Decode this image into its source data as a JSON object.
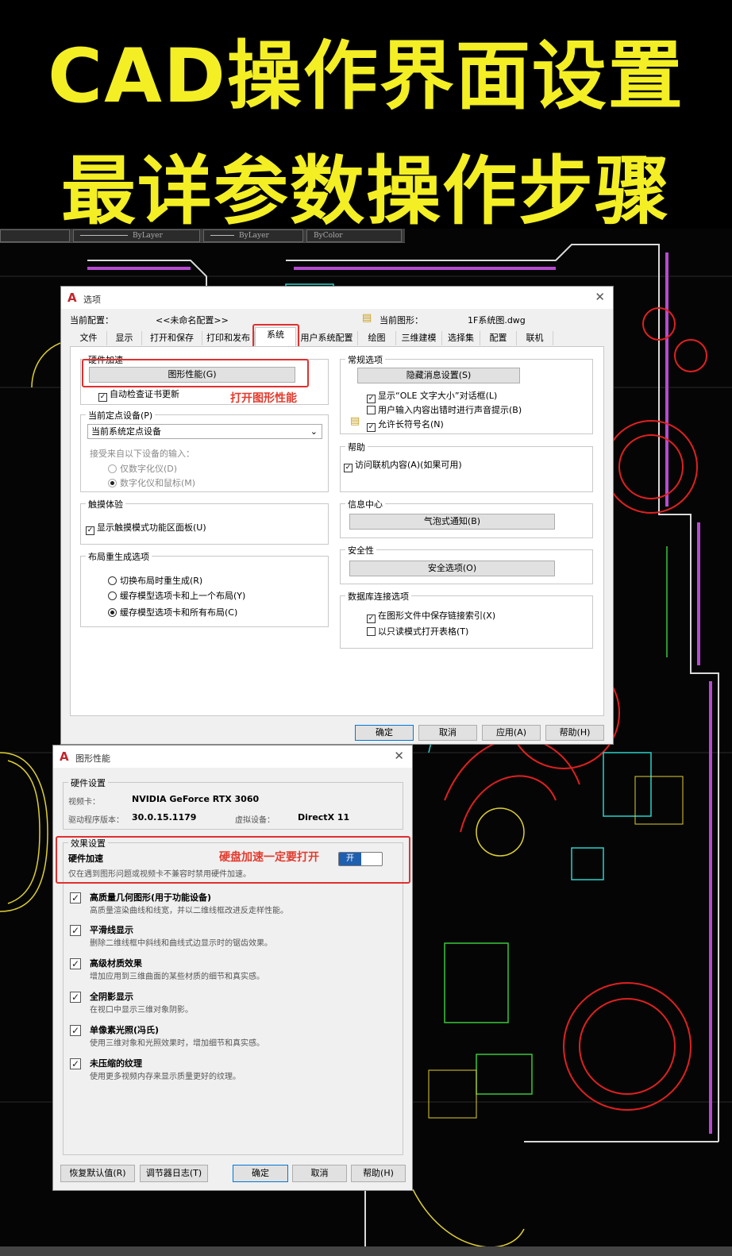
{
  "headline": {
    "line1": "CAD操作界面设置",
    "line2": "最详参数操作步骤"
  },
  "cad_toolbar": {
    "layer1": "ByLayer",
    "layer2": "ByLayer",
    "color": "ByColor"
  },
  "options_dialog": {
    "title": "选项",
    "current_profile_label": "当前配置：",
    "current_profile_value": "<<未命名配置>>",
    "current_drawing_label": "当前图形：",
    "current_drawing_value": "1F系统图.dwg",
    "tabs": [
      "文件",
      "显示",
      "打开和保存",
      "打印和发布",
      "系统",
      "用户系统配置",
      "绘图",
      "三维建模",
      "选择集",
      "配置",
      "联机"
    ],
    "hw_accel": {
      "legend": "硬件加速",
      "button": "图形性能(G)",
      "check": "自动检查证书更新"
    },
    "annotation_open": "打开图形性能",
    "pointing": {
      "legend": "当前定点设备(P)",
      "select_value": "当前系统定点设备",
      "accept_label": "接受来自以下设备的输入：",
      "radio1": "仅数字化仪(D)",
      "radio2": "数字化仪和鼠标(M)"
    },
    "touch": {
      "legend": "触摸体验",
      "check": "显示触摸模式功能区面板(U)"
    },
    "layout_regen": {
      "legend": "布局重生成选项",
      "radio1": "切换布局时重生成(R)",
      "radio2": "缓存模型选项卡和上一个布局(Y)",
      "radio3": "缓存模型选项卡和所有布局(C)"
    },
    "general": {
      "legend": "常规选项",
      "button": "隐藏消息设置(S)",
      "check1": "显示“OLE 文字大小”对话框(L)",
      "check2": "用户输入内容出错时进行声音提示(B)",
      "check3": "允许长符号名(N)"
    },
    "help": {
      "legend": "帮助",
      "check": "访问联机内容(A)(如果可用)"
    },
    "info_center": {
      "legend": "信息中心",
      "button": "气泡式通知(B)"
    },
    "security": {
      "legend": "安全性",
      "button": "安全选项(O)"
    },
    "db_connect": {
      "legend": "数据库连接选项",
      "check1": "在图形文件中保存链接索引(X)",
      "check2": "以只读模式打开表格(T)"
    },
    "footer": {
      "ok": "确定",
      "cancel": "取消",
      "apply": "应用(A)",
      "help": "帮助(H)"
    }
  },
  "graphics_dialog": {
    "title": "图形性能",
    "hw_settings": {
      "legend": "硬件设置",
      "gpu_label": "视频卡：",
      "gpu_value": "NVIDIA GeForce RTX 3060",
      "driver_label": "驱动程序版本：",
      "driver_value": "30.0.15.1179",
      "vdev_label": "虚拟设备：",
      "vdev_value": "DirectX 11"
    },
    "effects": {
      "legend": "效果设置",
      "hw_title": "硬件加速",
      "hw_desc": "仅在遇到图形问题或视频卡不兼容时禁用硬件加速。",
      "toggle": "开"
    },
    "annotation_hw": "硬盘加速一定要打开",
    "items": [
      {
        "title": "高质量几何图形(用于功能设备)",
        "desc": "高质量渲染曲线和线宽，并以二维线框改进反走样性能。"
      },
      {
        "title": "平滑线显示",
        "desc": "删除二维线框中斜线和曲线式边显示时的锯齿效果。"
      },
      {
        "title": "高级材质效果",
        "desc": "增加应用到三维曲面的某些材质的细节和真实感。"
      },
      {
        "title": "全阴影显示",
        "desc": "在视口中显示三维对象阴影。"
      },
      {
        "title": "单像素光照(冯氏)",
        "desc": "使用三维对象和光照效果时，增加细节和真实感。"
      },
      {
        "title": "未压缩的纹理",
        "desc": "使用更多视频内存来显示质量更好的纹理。"
      }
    ],
    "footer": {
      "reset": "恢复默认值(R)",
      "log": "调节器日志(T)",
      "ok": "确定",
      "cancel": "取消",
      "help": "帮助(H)"
    }
  }
}
